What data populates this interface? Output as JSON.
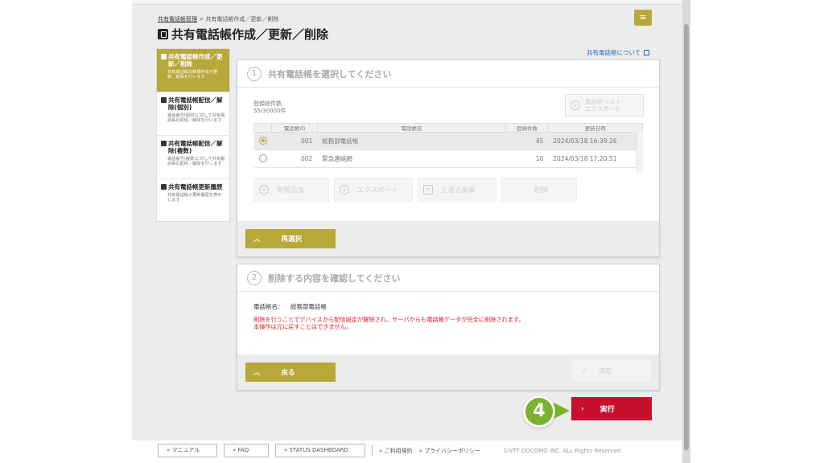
{
  "header": {
    "breadcrumb_parent": "共有電話帳管理",
    "breadcrumb_sep": " > ",
    "breadcrumb_current": "共有電話帳作成／更新／削除",
    "title": "共有電話帳作成／更新／削除",
    "menu_icon": "≡",
    "about_link": "共有電話帳について"
  },
  "sidebar": {
    "items": [
      {
        "title": "共有電話帳作成／更新／削除",
        "desc": "共有電話帳の新規作成や更新、削除を行います",
        "active": true
      },
      {
        "title": "共有電話帳配信／解除(個別)",
        "desc": "電話番号(個別)に対して共有電話帳の配信／解除を行います",
        "active": false
      },
      {
        "title": "共有電話帳配信／解除(複数)",
        "desc": "電話番号(複数)に対して共有電話帳の配信／解除を行います",
        "active": false
      },
      {
        "title": "共有電話帳更新履歴",
        "desc": "共有電話帳の更新履歴を表示します",
        "active": false
      }
    ]
  },
  "step1": {
    "num": "1",
    "title": "共有電話帳を選択してください",
    "total_label": "登録総件数",
    "total_value": "55/30000件",
    "export_list_line1": "電話帳リスト",
    "export_list_line2": "エクスポート",
    "columns": [
      "電話帳ID",
      "電話帳名",
      "登録件数",
      "更新日時"
    ],
    "rows": [
      {
        "id": "001",
        "name": "総務部電話帳",
        "count": "45",
        "updated": "2024/03/18 16:39:26",
        "selected": true
      },
      {
        "id": "002",
        "name": "緊急連絡網",
        "count": "10",
        "updated": "2024/03/18 17:20:51",
        "selected": false
      }
    ],
    "actions": {
      "new": "新規追加",
      "export": "エクスポート",
      "overwrite": "上書き編集",
      "delete": "削除"
    },
    "reselect": "再選択"
  },
  "step2": {
    "num": "2",
    "title": "削除する内容を確認してください",
    "phonebook_label": "電話帳名：",
    "phonebook_value": "総務部電話帳",
    "warning_line1": "削除を行うことでデバイスから配信設定が解除され、サーバからも電話帳データが完全に削除されます。",
    "warning_line2": "本操作は元に戻すことはできません。",
    "back": "戻る",
    "confirm": "決定"
  },
  "execute": {
    "label": "実行",
    "step_badge": "4"
  },
  "footer": {
    "manual": "マニュアル",
    "faq": "FAQ",
    "status": "STATUS DASHBOARD",
    "terms": "ご利用規約",
    "privacy": "プライバシーポリシー",
    "copyright": "©NTT DOCOMO INC. ALL Rights Reserved."
  },
  "colors": {
    "accent": "#b8a83a",
    "danger": "#c8102e",
    "warning_text": "#e0202a",
    "badge": "#7ab32e"
  }
}
